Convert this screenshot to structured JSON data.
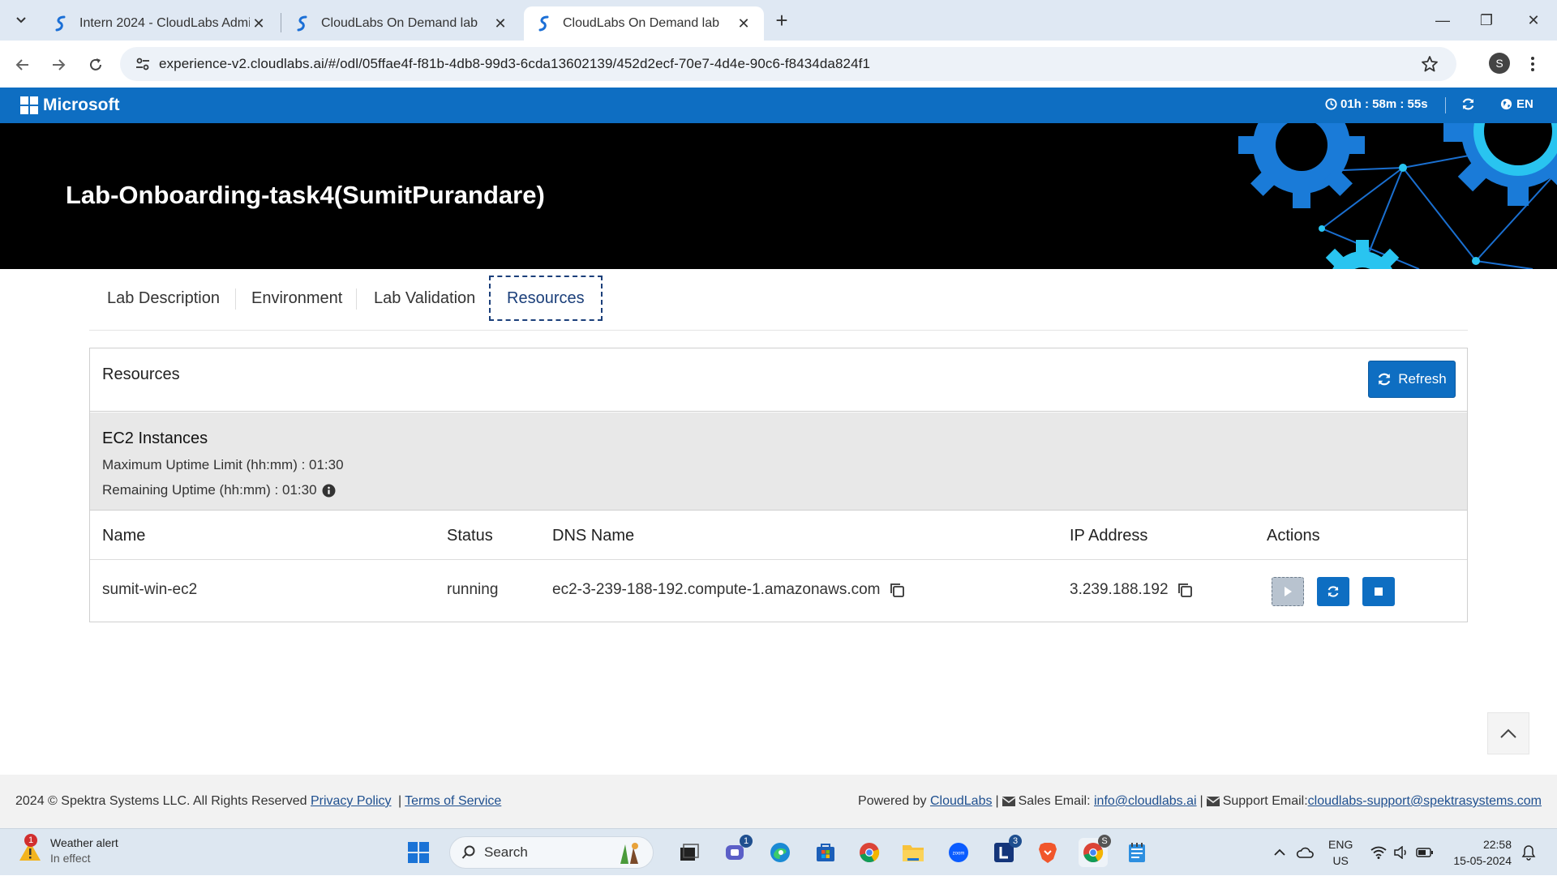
{
  "browser": {
    "tabs": [
      {
        "title": "Intern 2024 - CloudLabs Admin",
        "active": false
      },
      {
        "title": "CloudLabs On Demand lab",
        "active": false
      },
      {
        "title": "CloudLabs On Demand lab",
        "active": true
      }
    ],
    "url": "experience-v2.cloudlabs.ai/#/odl/05ffae4f-f81b-4db8-99d3-6cda13602139/452d2ecf-70e7-4d4e-90c6-f8434da824f1",
    "profile_initial": "S"
  },
  "header": {
    "brand": "Microsoft",
    "timer": "01h : 58m : 55s",
    "language": "EN",
    "brand_color": "#0e6ec2"
  },
  "banner": {
    "title": "Lab-Onboarding-task4(SumitPurandare)"
  },
  "lab_tabs": [
    {
      "label": "Lab Description",
      "active": false
    },
    {
      "label": "Environment",
      "active": false
    },
    {
      "label": "Lab Validation",
      "active": false
    },
    {
      "label": "Resources",
      "active": true
    }
  ],
  "resources": {
    "title": "Resources",
    "refresh_label": "Refresh",
    "ec2": {
      "title": "EC2 Instances",
      "max_uptime": "Maximum Uptime Limit (hh:mm) : 01:30",
      "remaining_uptime": "Remaining Uptime (hh:mm) : 01:30"
    },
    "columns": [
      "Name",
      "Status",
      "DNS Name",
      "IP Address",
      "Actions"
    ],
    "rows": [
      {
        "name": "sumit-win-ec2",
        "status": "running",
        "dns": "ec2-3-239-188-192.compute-1.amazonaws.com",
        "ip": "3.239.188.192"
      }
    ]
  },
  "footer": {
    "copyright": "2024 © Spektra Systems LLC. All Rights Reserved",
    "privacy": "Privacy Policy",
    "terms": "Terms of Service",
    "powered_by": "Powered by",
    "powered_link": "CloudLabs",
    "sales_label": "Sales Email:",
    "sales_email": "info@cloudlabs.ai",
    "support_label": "Support Email:",
    "support_email": "cloudlabs-support@spektrasystems.com"
  },
  "taskbar": {
    "weather_title": "Weather alert",
    "weather_sub": "In effect",
    "weather_badge": "1",
    "search_placeholder": "Search",
    "teams_badge": "1",
    "l_badge": "3",
    "chrome_badge": "S",
    "lang_top": "ENG",
    "lang_bottom": "US",
    "time": "22:58",
    "date": "15-05-2024"
  }
}
